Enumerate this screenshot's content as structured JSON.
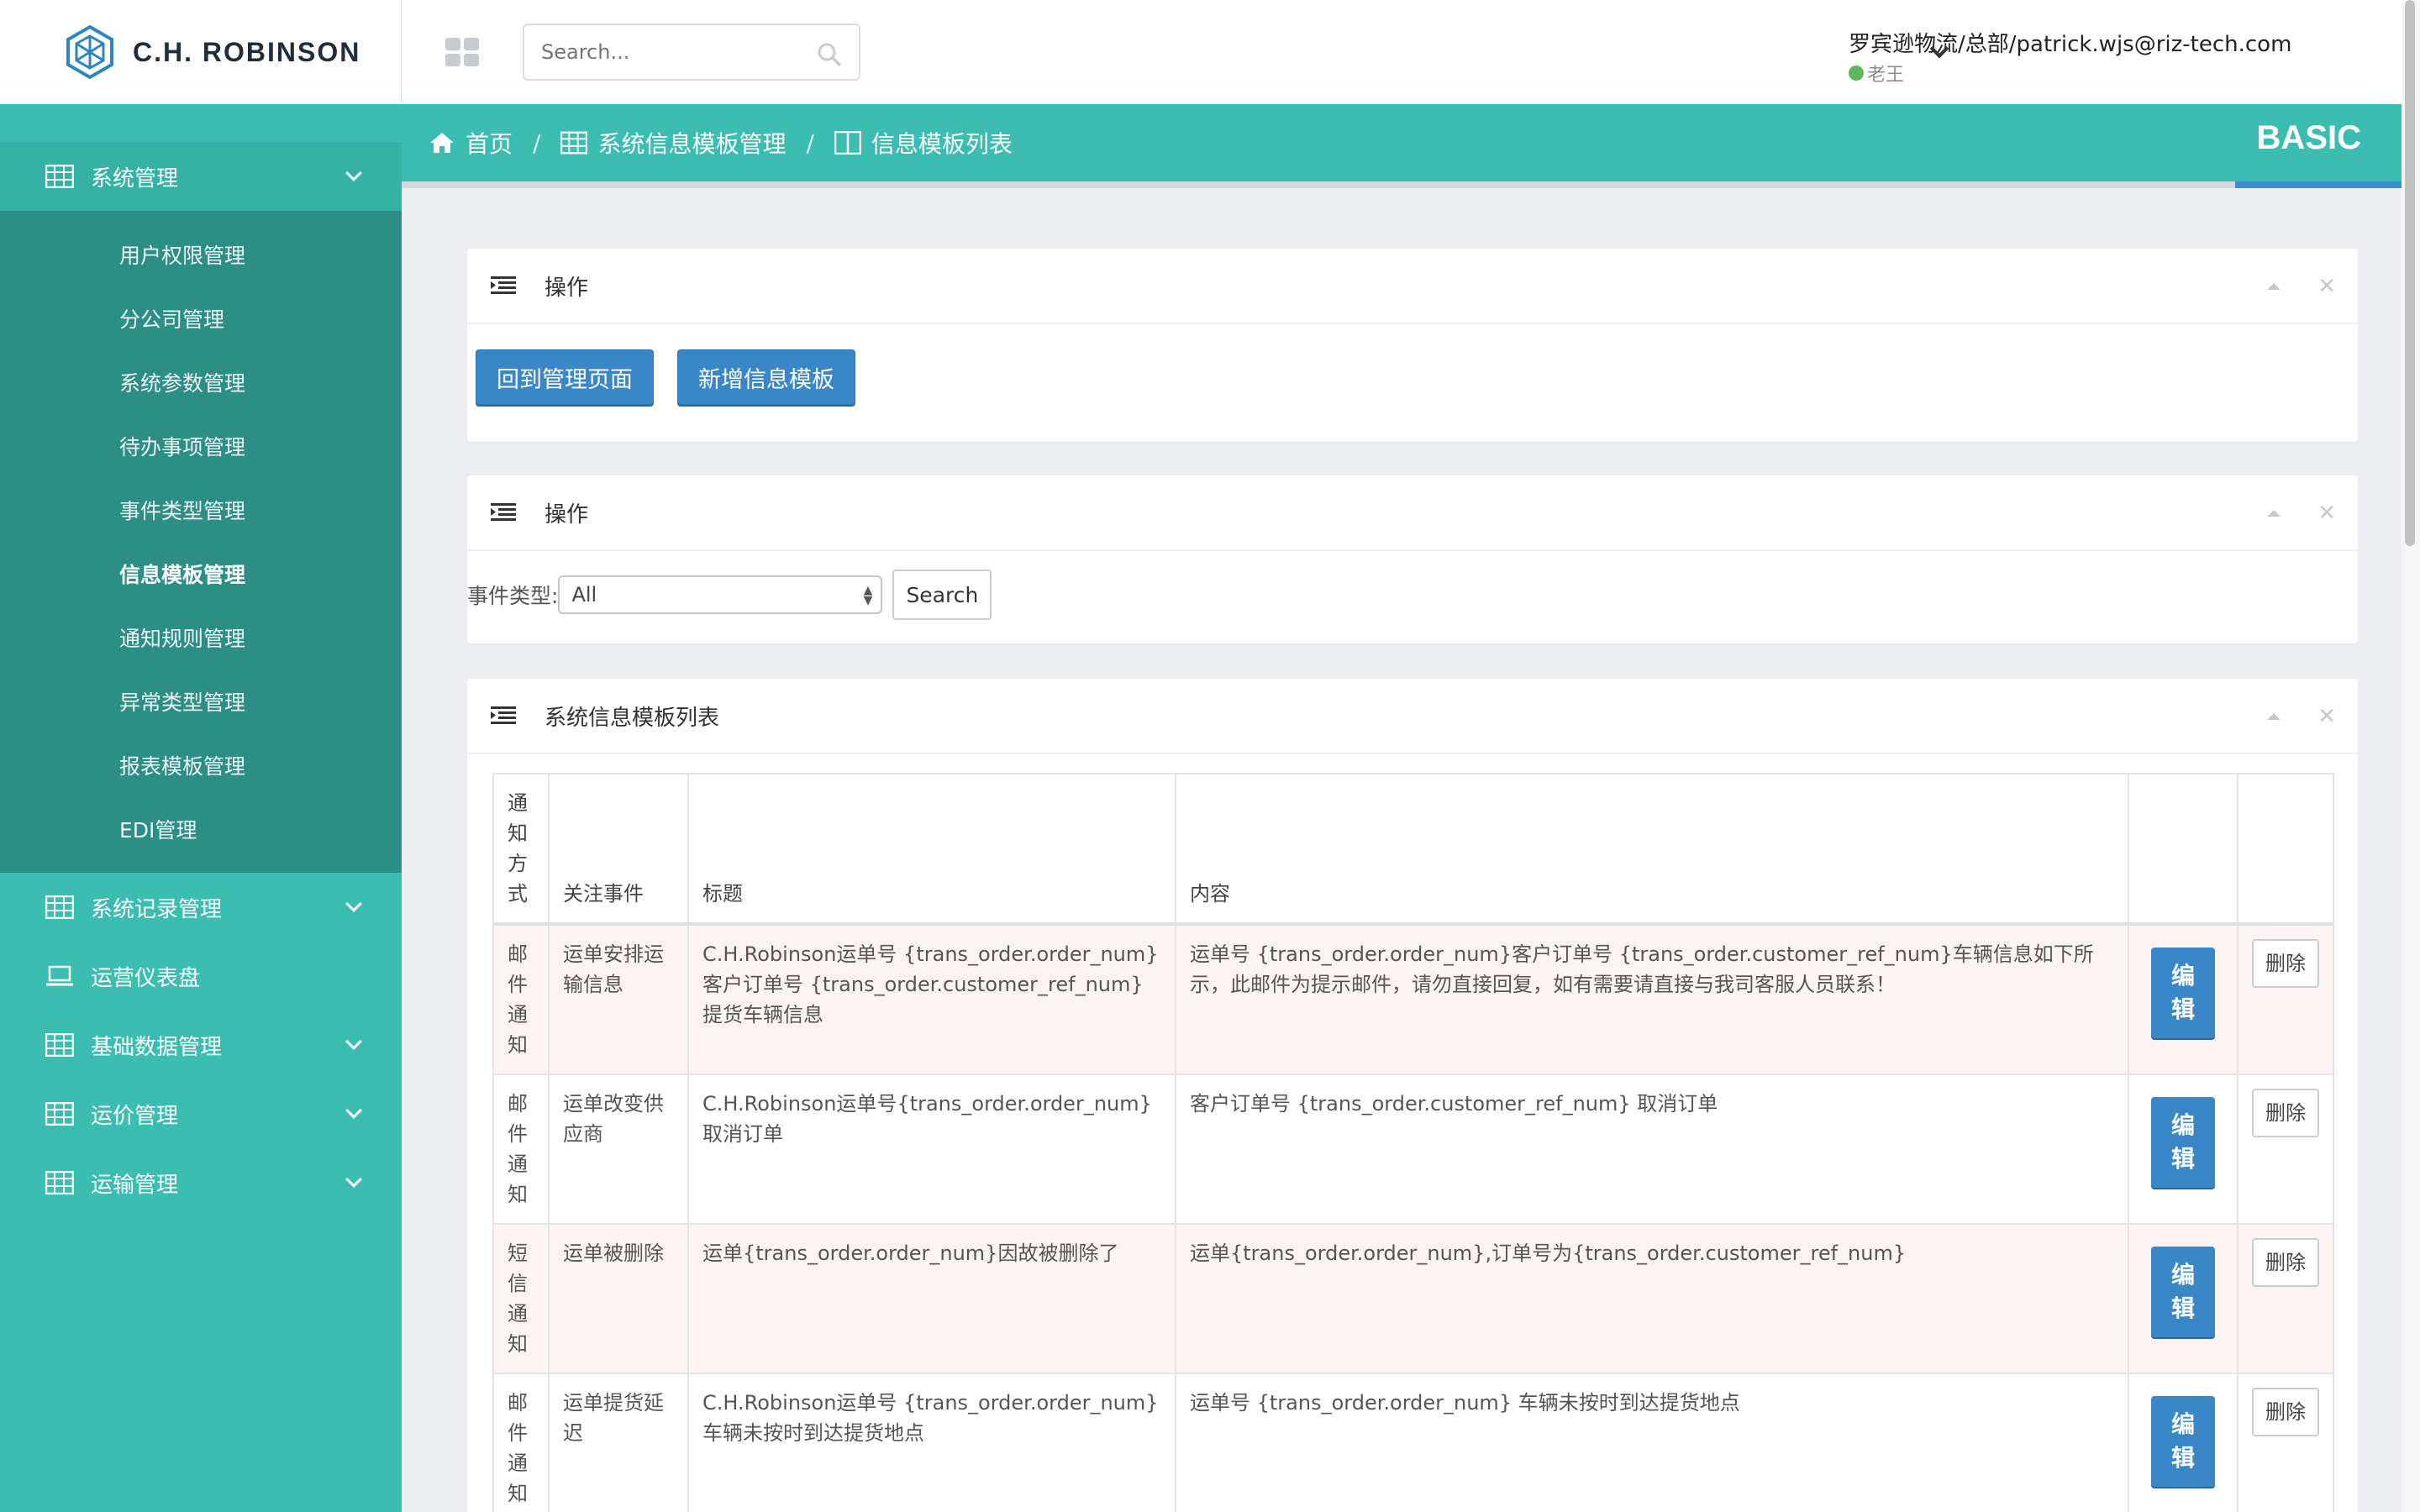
{
  "brand": {
    "name": "C.H. ROBINSON"
  },
  "topbar": {
    "search_placeholder": "Search...",
    "user_name": "罗宾逊物流/总部/patrick.wjs@riz-tech.com",
    "user_role": "老王"
  },
  "sidebar": {
    "items": [
      {
        "label": "系统管理",
        "icon": "table-icon",
        "expanded": true
      },
      {
        "label": "系统记录管理",
        "icon": "table-icon"
      },
      {
        "label": "运营仪表盘",
        "icon": "laptop-icon"
      },
      {
        "label": "基础数据管理",
        "icon": "table-icon"
      },
      {
        "label": "运价管理",
        "icon": "table-icon"
      },
      {
        "label": "运输管理",
        "icon": "table-icon"
      }
    ],
    "submenu": [
      "用户权限管理",
      "分公司管理",
      "系统参数管理",
      "待办事项管理",
      "事件类型管理",
      "信息模板管理",
      "通知规则管理",
      "异常类型管理",
      "报表模板管理",
      "EDI管理"
    ],
    "active_submenu": "信息模板管理"
  },
  "breadcrumb": {
    "home": "首页",
    "section": "系统信息模板管理",
    "page": "信息模板列表",
    "edition": "BASIC"
  },
  "panels": {
    "ops": {
      "title": "操作",
      "back_button": "回到管理页面",
      "add_button": "新增信息模板"
    },
    "filter": {
      "title": "操作",
      "event_label": "事件类型:",
      "event_value": "All",
      "search_button": "Search"
    },
    "list": {
      "title": "系统信息模板列表"
    }
  },
  "table": {
    "headers": {
      "mode": "通知方式",
      "event": "关注事件",
      "title": "标题",
      "content": "内容"
    },
    "edit_label": "编辑",
    "delete_label": "删除",
    "rows": [
      {
        "mode": "邮件通知",
        "event": "运单安排运输信息",
        "title": "C.H.Robinson运单号 {trans_order.order_num} 客户订单号 {trans_order.customer_ref_num} 提货车辆信息",
        "content": "运单号 {trans_order.order_num}客户订单号 {trans_order.customer_ref_num}车辆信息如下所示，此邮件为提示邮件，请勿直接回复，如有需要请直接与我司客服人员联系！"
      },
      {
        "mode": "邮件通知",
        "event": "运单改变供应商",
        "title": "C.H.Robinson运单号{trans_order.order_num} 取消订单",
        "content": "客户订单号 {trans_order.customer_ref_num} 取消订单"
      },
      {
        "mode": "短信通知",
        "event": "运单被删除",
        "title": "运单{trans_order.order_num}因故被删除了",
        "content": "运单{trans_order.order_num},订单号为{trans_order.customer_ref_num}"
      },
      {
        "mode": "邮件通知",
        "event": "运单提货延迟",
        "title": "C.H.Robinson运单号 {trans_order.order_num} 车辆未按时到达提货地点",
        "content": "运单号 {trans_order.order_num} 车辆未按时到达提货地点"
      }
    ]
  },
  "colors": {
    "sidebar": "#3cbdb2",
    "submenu": "#2d8e86",
    "primary_button": "#3a87c8",
    "odd_row": "#fdf3f2",
    "status_dot": "#5cb85c"
  }
}
